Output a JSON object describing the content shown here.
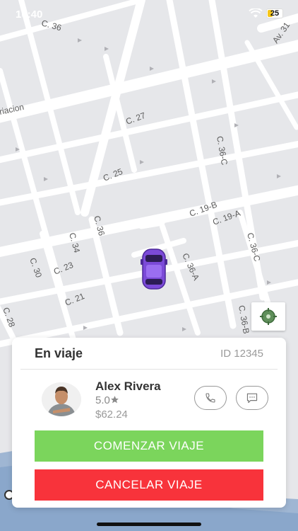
{
  "status_bar": {
    "time": "10:40",
    "battery_level": "25"
  },
  "map": {
    "street_labels": [
      "C. 36",
      "Av. 31",
      "riacion",
      "C. 27",
      "C. 36-C",
      "C. 25",
      "C. 19-B",
      "C. 19-A",
      "C. 36",
      "C. 34",
      "C. 36-A",
      "C. 36-C",
      "C. 30",
      "C. 23",
      "C. 21",
      "C. 28",
      "C. 36-B"
    ]
  },
  "trip_card": {
    "title": "En viaje",
    "trip_id": "ID 12345",
    "driver": {
      "name": "Alex Rivera",
      "rating": "5.0",
      "fare": "$62.24"
    },
    "start_label": "COMENZAR VIAJE",
    "cancel_label": "CANCELAR VIAJE"
  },
  "colors": {
    "start": "#7bd55c",
    "cancel": "#f8333b",
    "car": "#7b4ad8"
  },
  "icons": [
    "wifi-icon",
    "battery-icon",
    "locate-icon",
    "car-icon",
    "phone-icon",
    "message-icon",
    "star-icon",
    "compass-icon"
  ]
}
